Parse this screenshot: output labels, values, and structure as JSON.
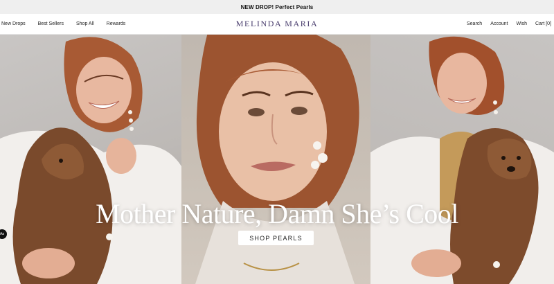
{
  "announcement": {
    "text": "NEW DROP! Perfect Pearls"
  },
  "header": {
    "logo": "MELINDA MARIA",
    "nav_left": [
      "New Drops",
      "Best Sellers",
      "Shop All",
      "Rewards"
    ],
    "nav_right": [
      "Search",
      "Account",
      "Wish",
      "Cart [0]"
    ]
  },
  "hero": {
    "headline": "Mother Nature, Damn She’s Cool",
    "cta": "SHOP PEARLS"
  },
  "accessibility": {
    "label": "Aa"
  }
}
